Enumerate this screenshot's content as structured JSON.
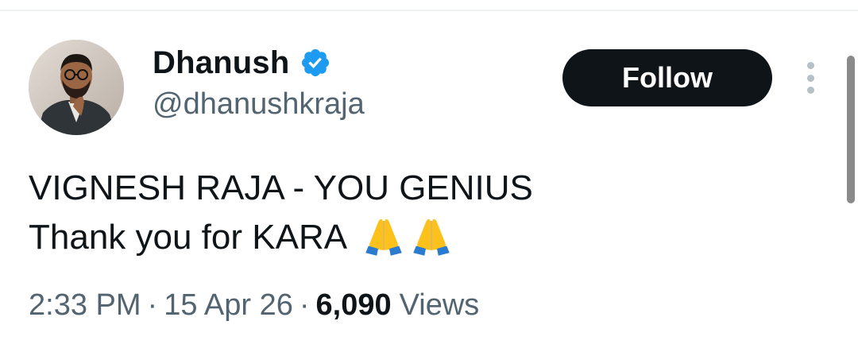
{
  "author": {
    "name": "Dhanush",
    "handle": "@dhanushkraja",
    "verified": true,
    "verified_color": "#1d9bf0"
  },
  "follow_button": {
    "label": "Follow",
    "background": "#0f1419"
  },
  "more_menu": {
    "icon": "more-vertical-icon"
  },
  "tweet": {
    "line1": "VIGNESH RAJA - YOU GENIUS",
    "line2": "Thank you for KARA",
    "emojis": [
      "folded-hands-icon",
      "folded-hands-icon"
    ]
  },
  "meta": {
    "time": "2:33 PM",
    "separator": "·",
    "date": "15 Apr 26",
    "views_count": "6,090",
    "views_label": "Views"
  }
}
